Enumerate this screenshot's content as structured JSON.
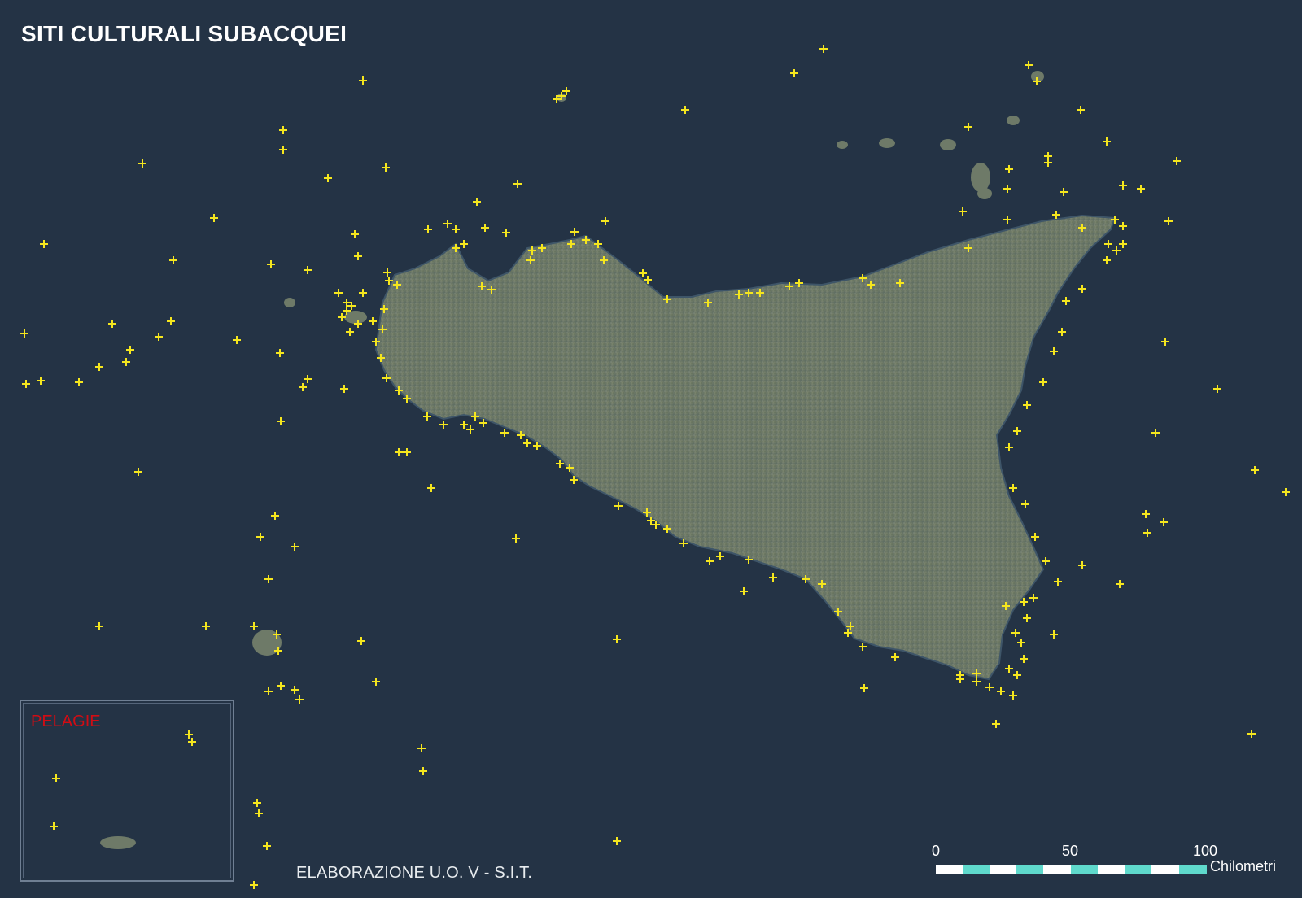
{
  "map": {
    "title": "SITI CULTURALI SUBACQUEI",
    "inset_label": "PELAGIE",
    "credit": "ELABORAZIONE U.O. V - S.I.T.",
    "scale_bar": {
      "ticks": [
        "0",
        "50",
        "100"
      ],
      "unit": "Chilometri"
    },
    "colors": {
      "sea": "#243345",
      "land": "#6e7a68",
      "site_marker": "#f5e61e",
      "inset_label": "#d10c14",
      "scale_accent": "#5fd9cc"
    },
    "legend_marker": "yellow-cross-icon"
  }
}
